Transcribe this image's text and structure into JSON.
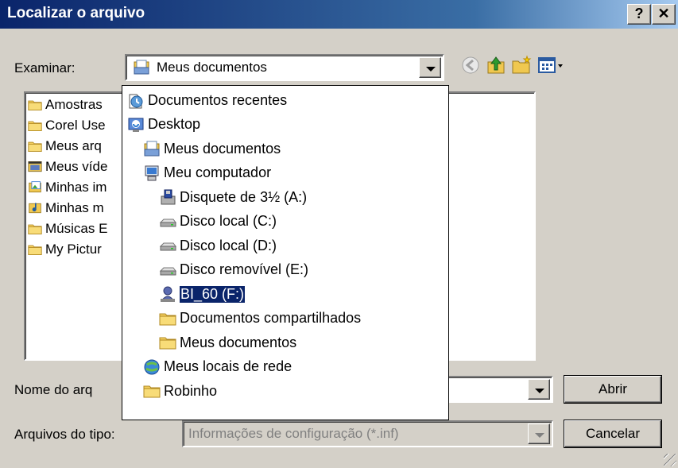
{
  "window": {
    "title": "Localizar o arquivo",
    "help_button": "?",
    "close_button": "✕"
  },
  "lookin": {
    "label": "Examinar:",
    "value": "Meus documentos"
  },
  "toolbar": {
    "back_icon": "back-icon",
    "up_icon": "up-folder-icon",
    "new_folder_icon": "new-folder-icon",
    "views_icon": "views-menu-icon"
  },
  "files": [
    {
      "label": "Amostras",
      "icon": "folder"
    },
    {
      "label": "Corel Use",
      "icon": "folder"
    },
    {
      "label": "Meus arq",
      "icon": "folder"
    },
    {
      "label": "Meus víde",
      "icon": "video"
    },
    {
      "label": "Minhas im",
      "icon": "pictures"
    },
    {
      "label": "Minhas m",
      "icon": "music"
    },
    {
      "label": "Músicas E",
      "icon": "folder"
    },
    {
      "label": "My Pictur",
      "icon": "folder"
    }
  ],
  "dropdown": [
    {
      "label": "Documentos recentes",
      "icon": "recent"
    },
    {
      "label": "Desktop",
      "icon": "desktop"
    },
    {
      "label": "Meus documentos",
      "icon": "mydocs"
    },
    {
      "label": "Meu computador",
      "icon": "computer"
    },
    {
      "label": "Disquete de 3½ (A:)",
      "icon": "floppy"
    },
    {
      "label": "Disco local (C:)",
      "icon": "drive"
    },
    {
      "label": "Disco local (D:)",
      "icon": "drive"
    },
    {
      "label": "Disco removível (E:)",
      "icon": "drive"
    },
    {
      "label": "BI_60 (F:)",
      "icon": "user",
      "selected": true
    },
    {
      "label": "Documentos compartilhados",
      "icon": "folder"
    },
    {
      "label": "Meus documentos",
      "icon": "folder"
    },
    {
      "label": "Meus locais de rede",
      "icon": "network"
    },
    {
      "label": "Robinho",
      "icon": "folder"
    }
  ],
  "filename": {
    "label": "Nome do arq",
    "value": ""
  },
  "filetype": {
    "label": "Arquivos do tipo:",
    "value": "Informações de configuração (*.inf)"
  },
  "buttons": {
    "open": "Abrir",
    "cancel": "Cancelar"
  },
  "colors": {
    "titlebar": "#0a246a",
    "selection": "#0a246a",
    "face": "#d4d0c8"
  }
}
